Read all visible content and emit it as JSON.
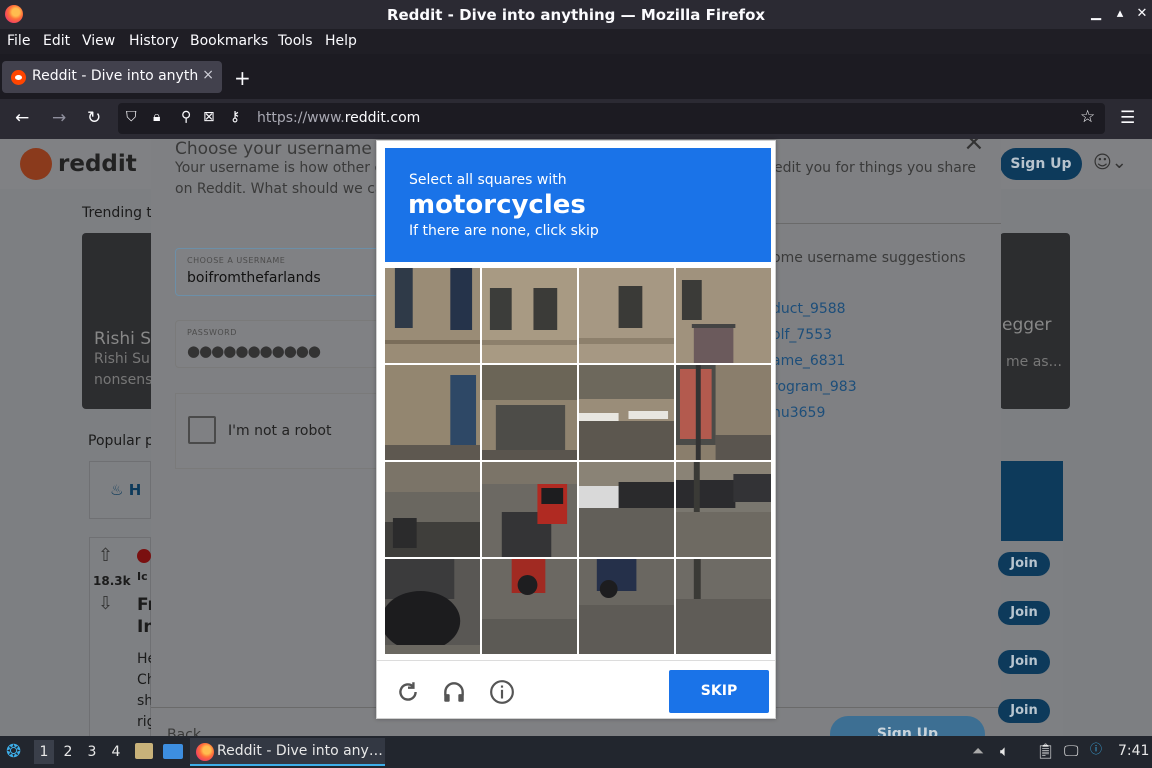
{
  "window": {
    "title": "Reddit - Dive into anything — Mozilla Firefox"
  },
  "menu": [
    "File",
    "Edit",
    "View",
    "History",
    "Bookmarks",
    "Tools",
    "Help"
  ],
  "tab": {
    "label": "Reddit - Dive into anything",
    "close": "×",
    "new": "+"
  },
  "url": {
    "prefix": "https://www.",
    "host": "reddit.com"
  },
  "reddit": {
    "logo_text": "reddit",
    "signup_top": "Sign Up",
    "trending": "Trending to",
    "card_left_title": "Rishi S",
    "card_left_sub1": "Rishi Sun",
    "card_left_sub2": "nonsens",
    "card_right_title": "egger",
    "card_right_sub": "me as...",
    "popular": "Popular p",
    "hot": "H",
    "votes": "18.3k",
    "post_sub": "Ic",
    "post_title1": "Fr",
    "post_title2": "In",
    "body": [
      "He",
      "Ch",
      "sh",
      "rig"
    ],
    "join": "Join"
  },
  "modal": {
    "title": "Choose your username",
    "desc": "Your username is how other co                                                          edit you for things you share on Reddit. What should we call",
    "desc1": "Your username is how other co",
    "desc1b": "edit you for things you share",
    "desc2": "on Reddit. What should we call",
    "close": "×",
    "username_label": "CHOOSE A USERNAME",
    "username_value": "boifromthefarlands",
    "password_label": "PASSWORD",
    "password_value": "●●●●●●●●●●●",
    "robot_label": "I'm not a robot",
    "suggestions_title": "ome username suggestions",
    "suggestions": [
      "duct_9588",
      "olf_7553",
      "ame_6831",
      "rogram_983",
      "nu3659"
    ],
    "back": "Back",
    "signup": "Sign Up"
  },
  "captcha": {
    "line1": "Select all squares with",
    "keyword": "motorcycles",
    "line3": "If there are none, click skip",
    "skip": "SKIP"
  },
  "taskbar": {
    "workspaces": [
      "1",
      "2",
      "3",
      "4"
    ],
    "task_label": "Reddit - Dive into any…",
    "time": "7:41"
  }
}
